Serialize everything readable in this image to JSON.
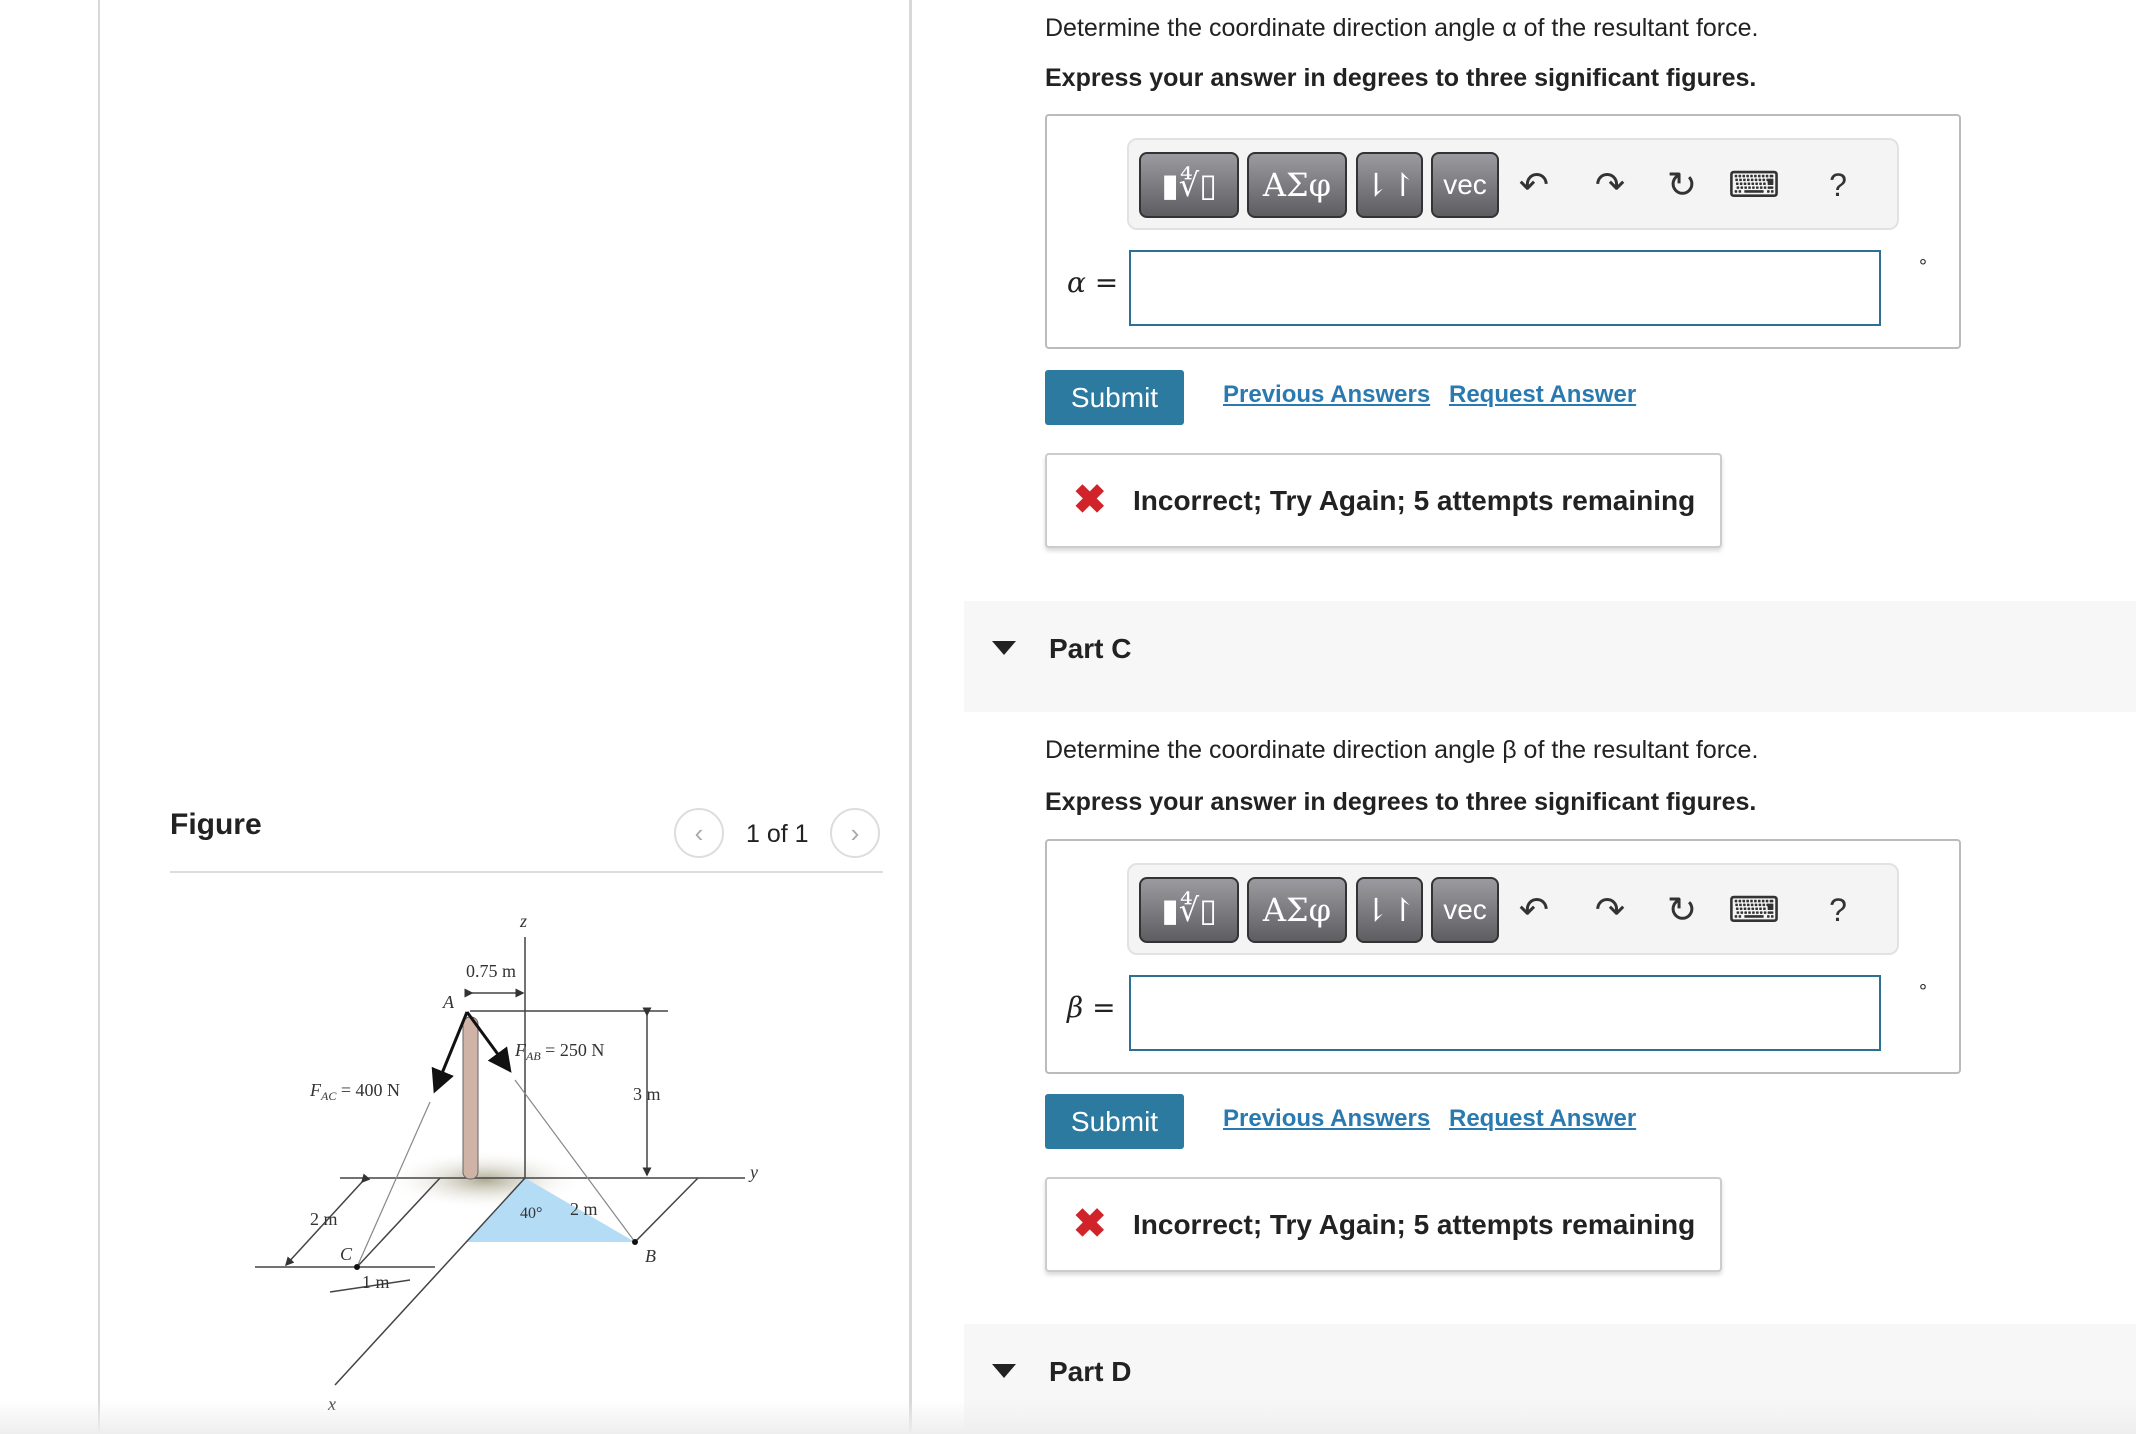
{
  "figure": {
    "title": "Figure",
    "counter": "1 of 1",
    "prev_icon": "chevron-left-icon",
    "next_icon": "chevron-right-icon",
    "labels": {
      "z": "z",
      "y": "y",
      "x": "x",
      "A": "A",
      "B": "B",
      "C": "C",
      "d075": "0.75 m",
      "fab": "F",
      "fab_sub": "AB",
      "fab_val": " = 250 N",
      "fac": "F",
      "fac_sub": "AC",
      "fac_val": " = 400 N",
      "d3": "3 m",
      "d2left": "2 m",
      "d1": "1 m",
      "angle": "40°",
      "d2": "2 m"
    },
    "colors": {
      "triangle": "#b5dcf5",
      "pole": "#cfb3a6"
    }
  },
  "partB": {
    "question": "Determine the coordinate direction angle α of the resultant force.",
    "instruction": "Express your answer in degrees to three significant figures.",
    "toolbar": {
      "templates": "▮∜▯",
      "greek": "ΑΣφ",
      "arrows": "⇂↾",
      "vec": "vec",
      "undo": "↶",
      "redo": "↷",
      "reset": "↻",
      "keyboard": "⌨",
      "help": "?"
    },
    "label": "α =",
    "value": "",
    "unit": "°",
    "submit": "Submit",
    "previous_answers": "Previous Answers",
    "request_answer": "Request Answer",
    "feedback": "Incorrect; Try Again; 5 attempts remaining"
  },
  "partC": {
    "title": "Part C",
    "question": "Determine the coordinate direction angle β of the resultant force.",
    "instruction": "Express your answer in degrees to three significant figures.",
    "label": "β =",
    "value": "",
    "unit": "°",
    "submit": "Submit",
    "previous_answers": "Previous Answers",
    "request_answer": "Request Answer",
    "feedback": "Incorrect; Try Again; 5 attempts remaining"
  },
  "partD": {
    "title": "Part D"
  },
  "colors": {
    "accent": "#2c7aa0",
    "link": "#2a7ab0",
    "error": "#d0232a"
  }
}
